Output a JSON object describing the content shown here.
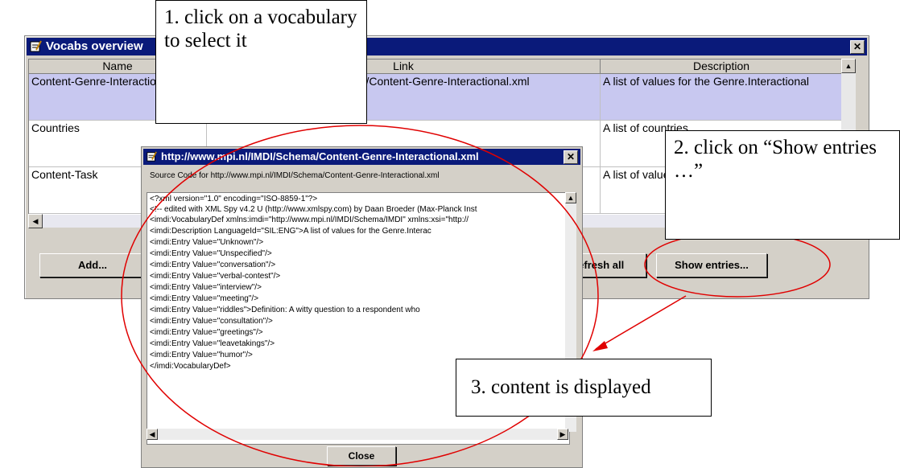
{
  "main_window": {
    "title": "Vocabs overview",
    "close_glyph": "✕",
    "columns": [
      "Name",
      "Link",
      "Description"
    ],
    "rows": [
      {
        "name": "Content-Genre-Interactional",
        "link": "http://www.mpi.nl/IMDI/Schema/Content-Genre-Interactional.xml",
        "description": "A list of values for the Genre.Interactional"
      },
      {
        "name": "Countries",
        "link": "",
        "description": "A list of countries"
      },
      {
        "name": "Content-Task",
        "link": "",
        "description": "A list of values for the Task"
      }
    ],
    "buttons": {
      "add": "Add...",
      "refresh_all": "Refresh all",
      "show_entries": "Show entries..."
    }
  },
  "popup": {
    "title": "http://www.mpi.nl/IMDI/Schema/Content-Genre-Interactional.xml",
    "subtitle": "Source Code for http://www.mpi.nl/IMDI/Schema/Content-Genre-Interactional.xml",
    "lines": [
      "<?xml version=\"1.0\" encoding=\"ISO-8859-1\"?>",
      "<!-- edited with XML Spy v4.2 U (http://www.xmlspy.com) by Daan Broeder (Max-Planck Inst",
      "<imdi:VocabularyDef xmlns:imdi=\"http://www.mpi.nl/IMDI/Schema/IMDI\" xmlns:xsi=\"http://",
      "            <imdi:Description LanguageId=\"SIL:ENG\">A list of values for the Genre.Interac",
      "            <imdi:Entry Value=\"Unknown\"/>",
      "            <imdi:Entry Value=\"Unspecified\"/>",
      "            <imdi:Entry Value=\"conversation\"/>",
      "            <imdi:Entry Value=\"verbal-contest\"/>",
      "            <imdi:Entry Value=\"interview\"/>",
      "            <imdi:Entry Value=\"meeting\"/>",
      "            <imdi:Entry Value=\"riddles\">Definition:    A witty question to a respondent who",
      "            <imdi:Entry Value=\"consultation\"/>",
      "            <imdi:Entry Value=\"greetings\"/>",
      "            <imdi:Entry Value=\"leavetakings\"/>",
      "            <imdi:Entry Value=\"humor\"/>",
      "</imdi:VocabularyDef>"
    ],
    "close_label": "Close"
  },
  "annotations": {
    "step1": "1. click on a vocabulary to select it",
    "step2": "2. click on “Show entries …”",
    "step3": "3. content is displayed"
  },
  "colors": {
    "titlebar": "#0a1a7a",
    "selection": "#c8c8f0",
    "annotation": "#e00000"
  },
  "icons": {
    "window_icon": "notepad-icon",
    "close": "close-icon"
  }
}
